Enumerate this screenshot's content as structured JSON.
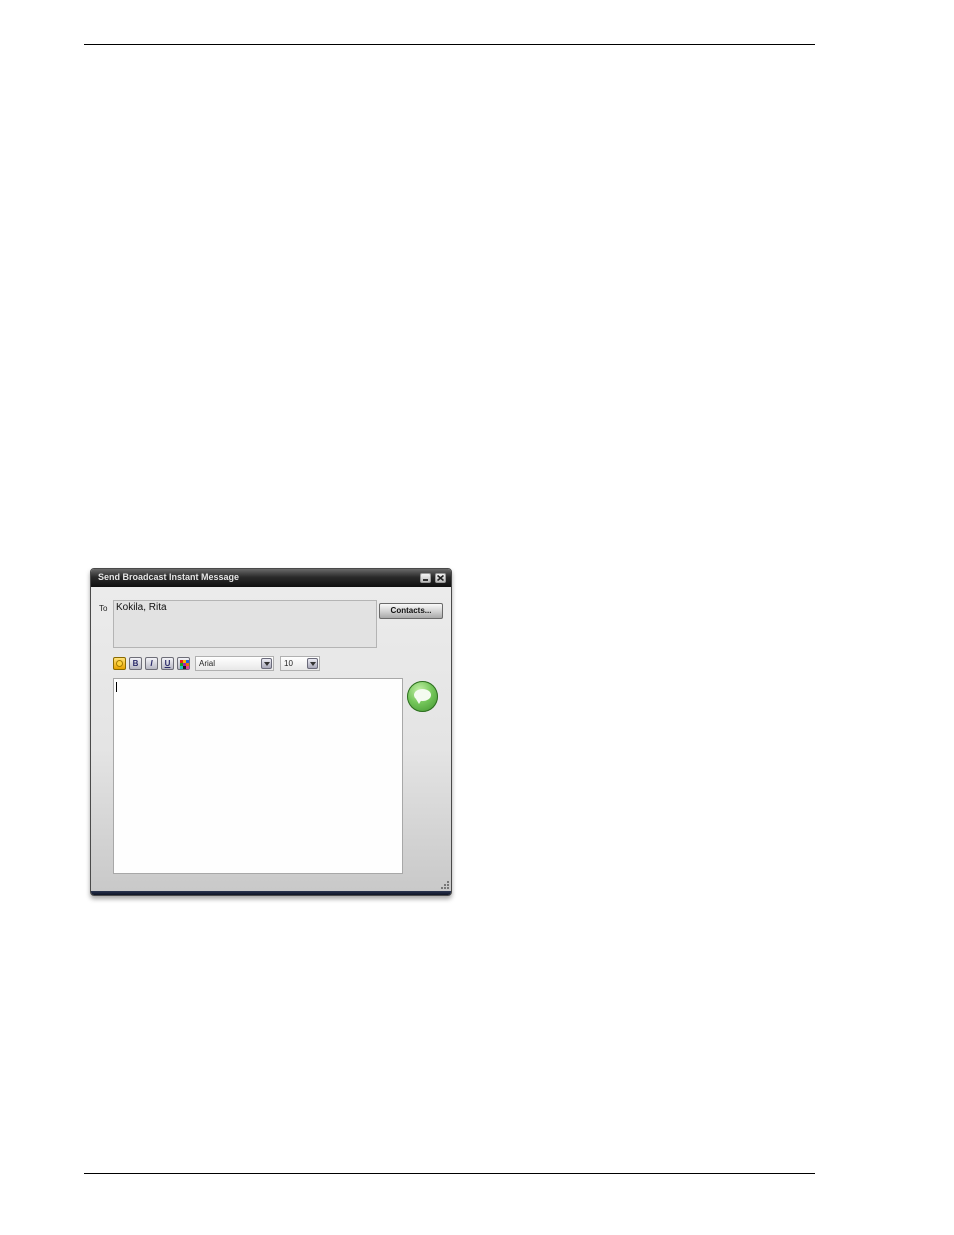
{
  "window": {
    "title": "Send Broadcast Instant Message"
  },
  "to_field": {
    "label": "To",
    "recipients": "Kokila, Rita"
  },
  "contacts_button": {
    "label": "Contacts..."
  },
  "formatting": {
    "bold_label": "B",
    "italic_label": "I",
    "underline_label": "U",
    "font_name": "Arial",
    "font_size": "10"
  },
  "message": {
    "text": ""
  },
  "icons": {
    "emoticon": "emoticon-icon",
    "color": "text-color-icon",
    "send": "send-message-icon",
    "minimize": "minimize-icon",
    "close": "close-icon",
    "resize": "resize-grip-icon"
  },
  "colors": {
    "titlebar": "#1a1a1a",
    "send_button": "#74c65a",
    "window_bg": "#e4e4e4"
  }
}
